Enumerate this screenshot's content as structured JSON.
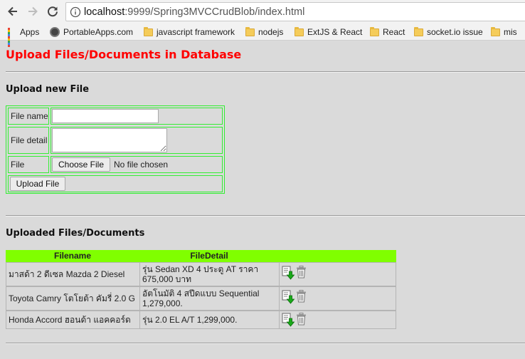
{
  "browser": {
    "url_host": "localhost",
    "url_path": ":9999/Spring3MVCCrudBlob/index.html",
    "bookmarks": [
      {
        "label": "Apps",
        "icon": "apps-grid-icon"
      },
      {
        "label": "PortableApps.com",
        "icon": "portableapps-icon"
      },
      {
        "label": "javascript framework",
        "icon": "folder-icon"
      },
      {
        "label": "nodejs",
        "icon": "folder-icon"
      },
      {
        "label": "ExtJS & React",
        "icon": "folder-icon"
      },
      {
        "label": "React",
        "icon": "folder-icon"
      },
      {
        "label": "socket.io issue",
        "icon": "folder-icon"
      },
      {
        "label": "mis",
        "icon": "folder-icon"
      }
    ]
  },
  "page": {
    "title": "Upload Files/Documents in Database",
    "title_color": "#ff0000"
  },
  "upload_form": {
    "heading": "Upload new File",
    "file_name_label": "File name",
    "file_name_value": "",
    "file_detail_label": "File detail",
    "file_detail_value": "",
    "file_label": "File",
    "choose_file_button": "Choose File",
    "no_file_text": "No file chosen",
    "upload_button": "Upload File",
    "border_color": "#33ee33"
  },
  "files": {
    "heading": "Uploaded Files/Documents",
    "header_color": "#80ff00",
    "columns": [
      "Filename",
      "FileDetail"
    ],
    "rows": [
      {
        "filename": "มาสด้า 2 ดีเซล Mazda 2 Diesel",
        "detail": "รุ่น Sedan XD 4 ประตู AT ราคา 675,000 บาท",
        "download_icon": "download-icon",
        "delete_icon": "trash-icon"
      },
      {
        "filename": "Toyota Camry โตโยต้า คัมรี่ 2.0 G",
        "detail": "อัตโนมัติ 4 สปีดแบบ Sequential 1,279,000.",
        "download_icon": "download-icon",
        "delete_icon": "trash-icon"
      },
      {
        "filename": "Honda Accord ฮอนด้า แอคคอร์ด",
        "detail": "รุ่น 2.0 EL A/T 1,299,000.",
        "download_icon": "download-icon",
        "delete_icon": "trash-icon"
      }
    ]
  }
}
